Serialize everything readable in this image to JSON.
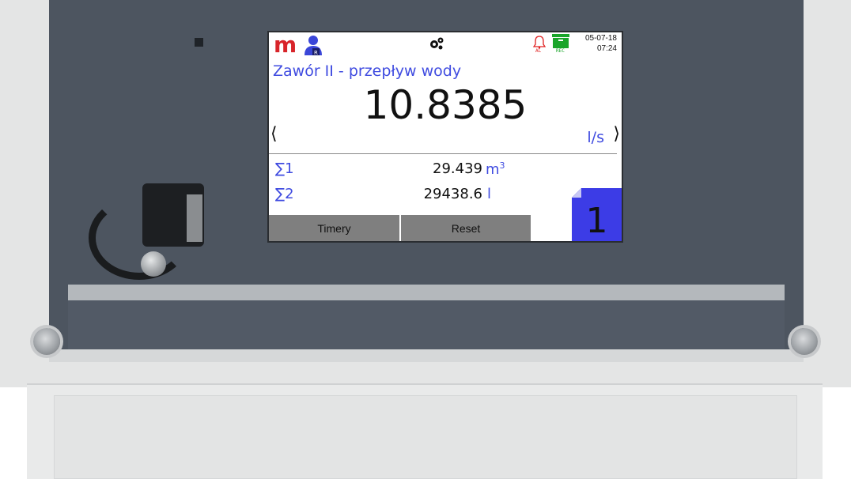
{
  "header": {
    "logo": "m",
    "date": "05-07-18",
    "time": "07:24",
    "alarm_tag": "AL",
    "rec_tag": "REC",
    "icons": [
      "user-icon",
      "gear-icon",
      "alarm-bell-icon",
      "rec-archive-icon"
    ]
  },
  "measurement": {
    "title": "Zawór II - przepływ wody",
    "value": "10.8385",
    "unit": "l/s",
    "prev_symbol": "⟨",
    "next_symbol": "⟩"
  },
  "totalizers": [
    {
      "label": "∑1",
      "value": "29.439",
      "unit": "m",
      "unit_sup": "3"
    },
    {
      "label": "∑2",
      "value": "29438.6",
      "unit": "l",
      "unit_sup": ""
    }
  ],
  "softkeys": {
    "timers": "Timery",
    "reset": "Reset"
  },
  "page_number": "1",
  "colors": {
    "accent_blue": "#3f4be0",
    "logo_red": "#d8242a",
    "rec_green": "#1aa52a",
    "badge_blue": "#3c3ce6",
    "softkey_gray": "#7f7f7f"
  }
}
